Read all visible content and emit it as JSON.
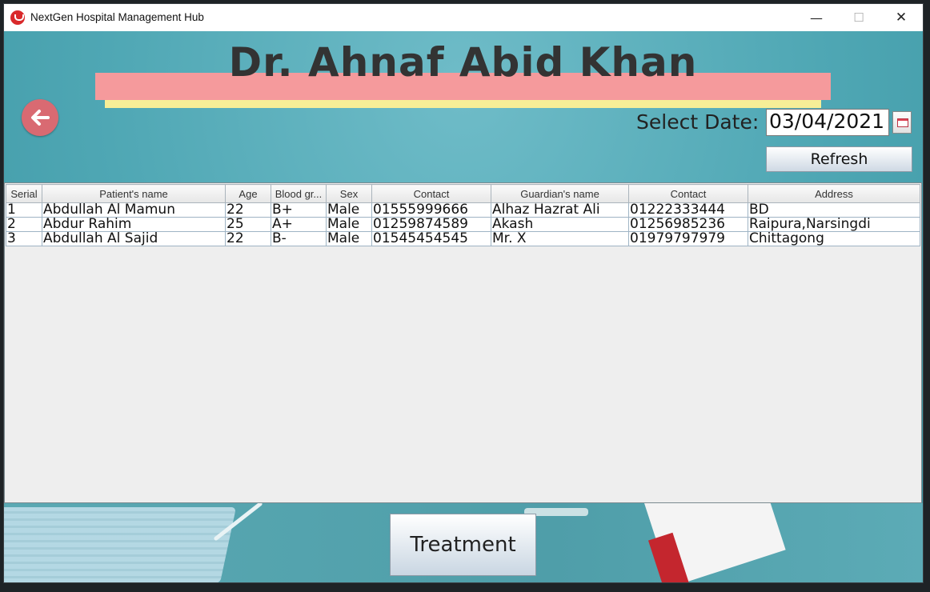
{
  "window": {
    "title": "NextGen Hospital Management Hub",
    "minimize_glyph": "—",
    "maximize_glyph": "☐",
    "close_glyph": "✕"
  },
  "header": {
    "doctor_name": "Dr. Ahnaf Abid Khan",
    "back_icon": "arrow-left-icon"
  },
  "date_picker": {
    "label": "Select Date:",
    "value": "03/04/2021",
    "calendar_icon": "calendar-icon"
  },
  "refresh_label": "Refresh",
  "table": {
    "columns": [
      "Serial",
      "Patient's name",
      "Age",
      "Blood gr...",
      "Sex",
      "Contact",
      "Guardian's name",
      "Contact",
      "Address"
    ],
    "rows": [
      [
        "1",
        "Abdullah Al Mamun",
        "22",
        "B+",
        "Male",
        "01555999666",
        "Alhaz Hazrat Ali",
        "01222333444",
        "BD"
      ],
      [
        "2",
        "Abdur Rahim",
        "25",
        "A+",
        "Male",
        "01259874589",
        "Akash",
        "01256985236",
        "Raipura,Narsingdi"
      ],
      [
        "3",
        "Abdullah Al Sajid",
        "22",
        "B-",
        "Male",
        "01545454545",
        "Mr. X",
        "01979797979",
        "Chittagong"
      ]
    ]
  },
  "treatment_label": "Treatment",
  "colors": {
    "title_banner_pink": "#f59a9c",
    "title_banner_yellow": "#f7ee97",
    "background_teal": "#4fa7b4",
    "back_button": "#d96a72"
  }
}
